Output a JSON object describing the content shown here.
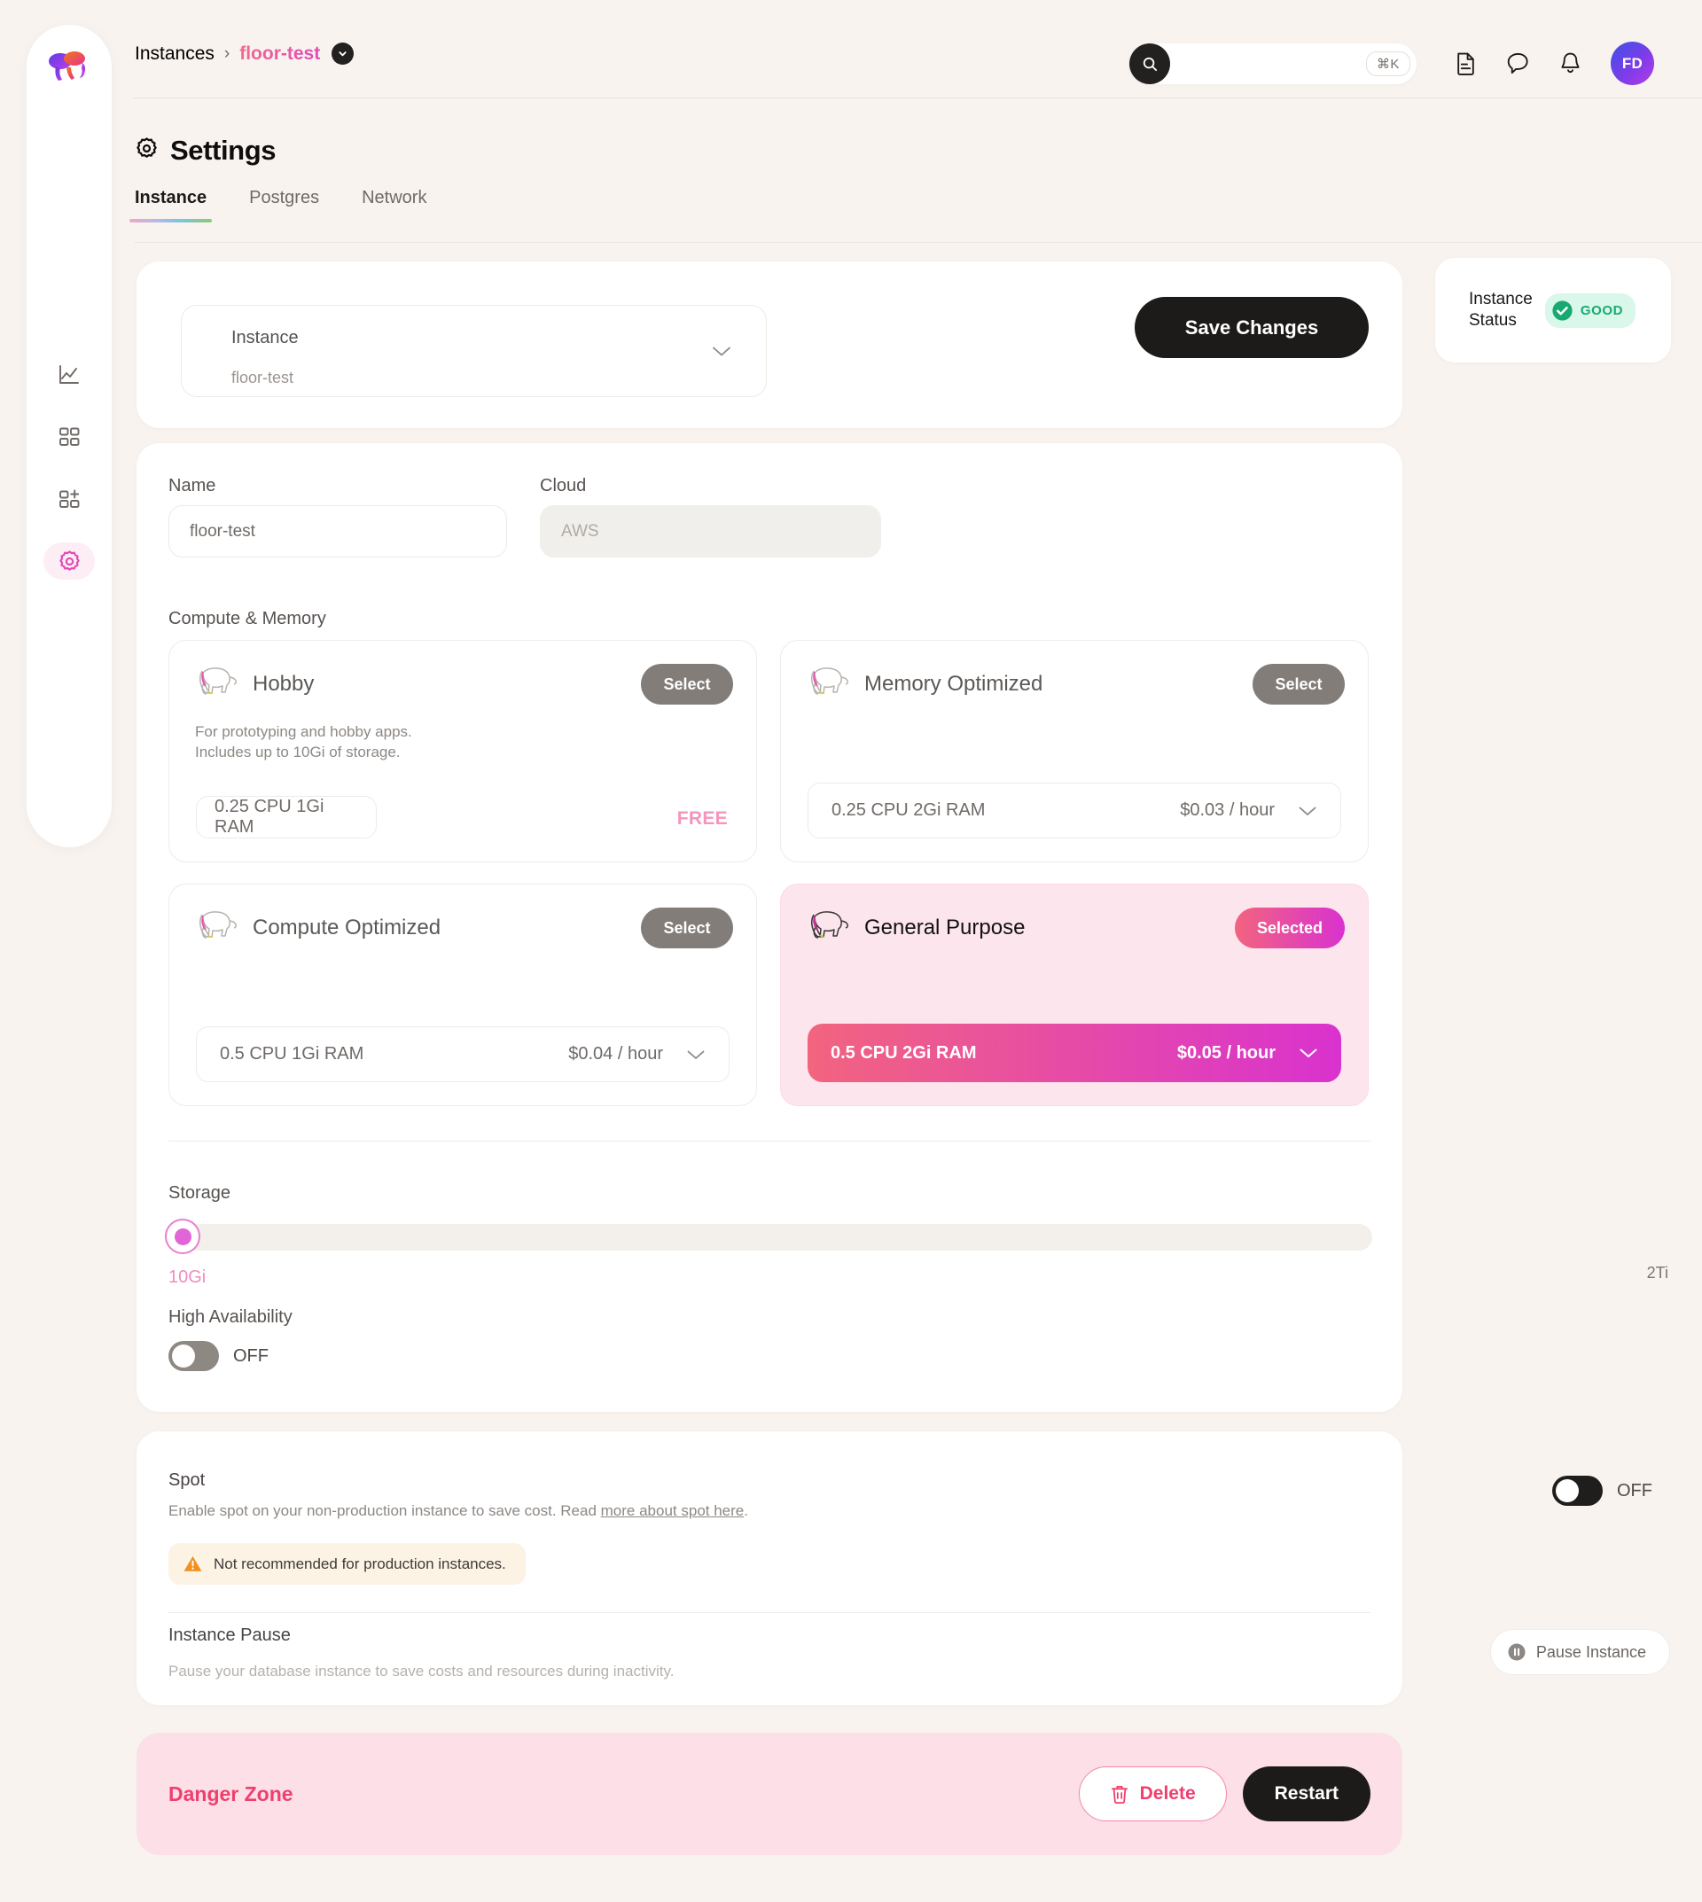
{
  "colors": {
    "page_bg": "#f8f3ef",
    "accent_pink": "#e04bb8",
    "accent_coral": "#f2647f",
    "danger": "#ef3f6e",
    "good_green": "#18a971",
    "warn_amber": "#f0901e",
    "dark": "#1d1b1a"
  },
  "sidebar": {
    "logo_name": "elephant-logo",
    "items": [
      {
        "icon": "analytics-chart-icon",
        "name": "analytics",
        "active": false
      },
      {
        "icon": "grid-icon",
        "name": "instances",
        "active": false
      },
      {
        "icon": "grid-plus-icon",
        "name": "new-instance",
        "active": false
      },
      {
        "icon": "gear-icon",
        "name": "settings",
        "active": true
      }
    ]
  },
  "header": {
    "breadcrumb": {
      "root": "Instances",
      "separator": "›",
      "current": "floor-test",
      "chevron_icon": "chevron-down-icon"
    },
    "search": {
      "placeholder": "",
      "value": "",
      "shortcut": "⌘K",
      "icon": "search-icon"
    },
    "actions": [
      {
        "icon": "document-icon",
        "name": "docs"
      },
      {
        "icon": "chat-bubble-icon",
        "name": "support-chat"
      },
      {
        "icon": "bell-icon",
        "name": "notifications"
      }
    ],
    "avatar_initials": "FD"
  },
  "page": {
    "title": "Settings",
    "title_icon": "gear-icon",
    "tabs": [
      {
        "label": "Instance",
        "active": true
      },
      {
        "label": "Postgres",
        "active": false
      },
      {
        "label": "Network",
        "active": false
      }
    ]
  },
  "instance_selector": {
    "label": "Instance",
    "value": "floor-test",
    "chevron_icon": "chevron-down-icon"
  },
  "save_button_label": "Save Changes",
  "status_card": {
    "label_line1": "Instance",
    "label_line2": "Status",
    "badge_text": "GOOD",
    "badge_icon": "check-circle-icon"
  },
  "form": {
    "name_label": "Name",
    "name_value": "floor-test",
    "cloud_label": "Cloud",
    "cloud_value": "AWS",
    "compute_label": "Compute & Memory"
  },
  "plans": [
    {
      "name": "Hobby",
      "icon": "elephant-icon",
      "button_label": "Select",
      "selected": false,
      "description": "For prototyping and hobby apps.\nIncludes up to 10Gi of storage.",
      "spec": "0.25 CPU 1Gi RAM",
      "price": "FREE",
      "is_free": true
    },
    {
      "name": "Memory Optimized",
      "icon": "elephant-icon",
      "button_label": "Select",
      "selected": false,
      "description": "",
      "spec": "0.25 CPU 2Gi RAM",
      "price": "$0.03 / hour",
      "is_free": false
    },
    {
      "name": "Compute Optimized",
      "icon": "elephant-icon",
      "button_label": "Select",
      "selected": false,
      "description": "",
      "spec": "0.5 CPU 1Gi RAM",
      "price": "$0.04 / hour",
      "is_free": false
    },
    {
      "name": "General Purpose",
      "icon": "elephant-icon",
      "button_label": "Selected",
      "selected": true,
      "description": "",
      "spec": "0.5 CPU 2Gi RAM",
      "price": "$0.05 / hour",
      "is_free": false
    }
  ],
  "storage": {
    "label": "Storage",
    "min_label": "10Gi",
    "max_label": "2Ti",
    "value_percent": 0
  },
  "high_availability": {
    "label": "High Availability",
    "state": "OFF",
    "on": false
  },
  "spot": {
    "title": "Spot",
    "description_prefix": "Enable spot on your non-production instance to save cost. Read ",
    "link_text": "more about spot here",
    "description_suffix": ".",
    "toggle_state": "OFF",
    "on": false,
    "warning_text": "Not recommended for production instances.",
    "warning_icon": "warning-triangle-icon"
  },
  "instance_pause": {
    "title": "Instance Pause",
    "description": "Pause your database instance to save costs and resources during inactivity.",
    "button_label": "Pause Instance",
    "button_icon": "pause-circle-icon"
  },
  "danger_zone": {
    "title": "Danger Zone",
    "delete_label": "Delete",
    "delete_icon": "trash-icon",
    "restart_label": "Restart"
  }
}
